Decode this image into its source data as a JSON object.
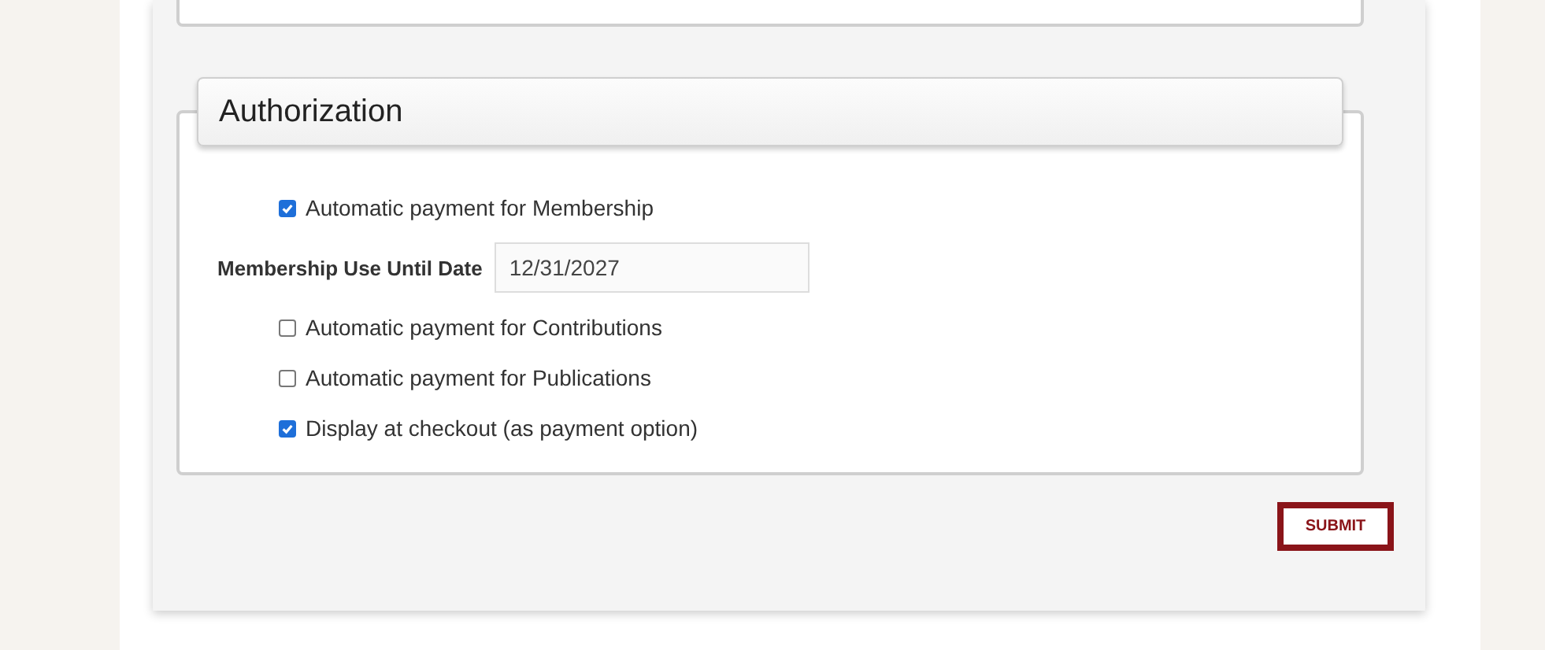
{
  "section": {
    "title": "Authorization"
  },
  "fields": [
    {
      "kind": "checkbox",
      "label": "Automatic payment for Membership",
      "checked": true
    },
    {
      "kind": "text",
      "label": "Membership Use Until Date",
      "value": "12/31/2027"
    },
    {
      "kind": "checkbox",
      "label": "Automatic payment for Contributions",
      "checked": false
    },
    {
      "kind": "checkbox",
      "label": "Automatic payment for Publications",
      "checked": false
    },
    {
      "kind": "checkbox",
      "label": "Display at checkout (as payment option)",
      "checked": true
    }
  ],
  "submit": {
    "label": "SUBMIT"
  }
}
